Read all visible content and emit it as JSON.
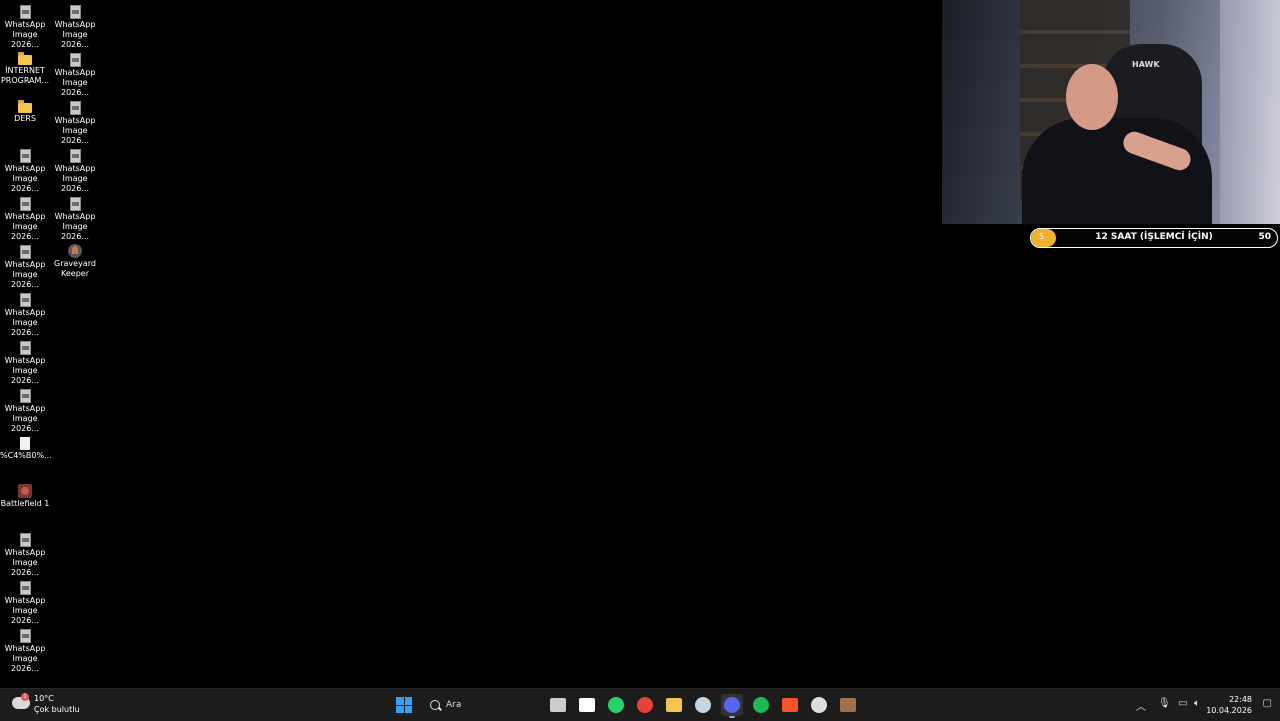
{
  "desktop": {
    "left_column": [
      {
        "label": "WhatsApp\nImage 2026...",
        "icon": "image-file-icon"
      },
      {
        "label": "İNTERNET\nPROGRAM...",
        "icon": "folder-icon"
      },
      {
        "label": "DERS",
        "icon": "folder-icon"
      },
      {
        "label": "WhatsApp\nImage 2026...",
        "icon": "image-file-icon"
      },
      {
        "label": "WhatsApp\nImage 2026...",
        "icon": "image-file-icon"
      },
      {
        "label": "WhatsApp\nImage 2026...",
        "icon": "image-file-icon"
      },
      {
        "label": "WhatsApp\nImage 2026...",
        "icon": "image-file-icon"
      },
      {
        "label": "WhatsApp\nImage 2026...",
        "icon": "image-file-icon"
      },
      {
        "label": "WhatsApp\nImage 2026...",
        "icon": "image-file-icon"
      },
      {
        "label": "%C4%B0%...",
        "icon": "document-icon"
      },
      {
        "label": "Battlefield 1",
        "icon": "battlefield-game-icon"
      },
      {
        "label": "WhatsApp\nImage 2026...",
        "icon": "image-file-icon"
      },
      {
        "label": "WhatsApp\nImage 2026...",
        "icon": "image-file-icon"
      },
      {
        "label": "WhatsApp\nImage 2026...",
        "icon": "image-file-icon"
      }
    ],
    "right_column": [
      {
        "label": "WhatsApp\nImage 2026...",
        "icon": "image-file-icon"
      },
      {
        "label": "WhatsApp\nImage 2026...",
        "icon": "image-file-icon"
      },
      {
        "label": "WhatsApp\nImage 2026...",
        "icon": "image-file-icon"
      },
      {
        "label": "WhatsApp\nImage 2026...",
        "icon": "image-file-icon"
      },
      {
        "label": "WhatsApp\nImage 2026...",
        "icon": "image-file-icon"
      },
      {
        "label": "Graveyard\nKeeper",
        "icon": "graveyard-keeper-game-icon"
      }
    ]
  },
  "webcam": {
    "chair_logo": "HAWK"
  },
  "goal": {
    "title": "12 SAAT (İŞLEMCİ İÇİN)",
    "current": "5",
    "target": "50",
    "progress_fraction": 0.1,
    "color": "#f0b12e"
  },
  "taskbar": {
    "weather": {
      "temp": "10°C",
      "desc": "Çok bulutlu",
      "badge": "1"
    },
    "search_placeholder": "Ara",
    "apps": [
      {
        "name": "task-view-icon",
        "color": "#cccccc"
      },
      {
        "name": "microsoft-store-icon",
        "color": "#ffffff"
      },
      {
        "name": "whatsapp-icon",
        "color": "#25d366"
      },
      {
        "name": "chrome-icon",
        "color": "#e84135"
      },
      {
        "name": "file-explorer-icon",
        "color": "#f4c54a"
      },
      {
        "name": "steam-icon",
        "color": "#c7d5e0"
      },
      {
        "name": "discord-icon",
        "color": "#5865f2"
      },
      {
        "name": "spotify-icon",
        "color": "#1db954"
      },
      {
        "name": "brave-icon",
        "color": "#fb542b"
      },
      {
        "name": "obs-icon",
        "color": "#dddddd"
      },
      {
        "name": "game-app-icon",
        "color": "#a07050"
      }
    ],
    "time": "22:48",
    "date": "10.04.2026"
  }
}
